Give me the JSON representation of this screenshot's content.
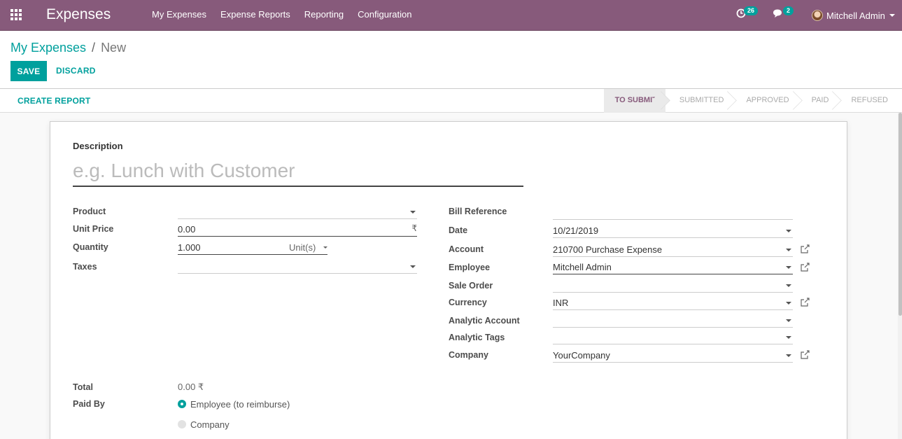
{
  "navbar": {
    "app_title": "Expenses",
    "menu": [
      "My Expenses",
      "Expense Reports",
      "Reporting",
      "Configuration"
    ],
    "activity_count": "26",
    "message_count": "2",
    "user_name": "Mitchell Admin",
    "bg_color": "#875a7b"
  },
  "breadcrumb": {
    "parent": "My Expenses",
    "separator": "/",
    "current": "New"
  },
  "buttons": {
    "save": "SAVE",
    "discard": "DISCARD",
    "create_report": "CREATE REPORT"
  },
  "status_stages": {
    "items": [
      "TO SUBMIT",
      "SUBMITTED",
      "APPROVED",
      "PAID",
      "REFUSED"
    ],
    "active": "TO SUBMIT"
  },
  "form": {
    "description_label": "Description",
    "description_placeholder": "e.g. Lunch with Customer",
    "left": {
      "product_label": "Product",
      "product_value": "",
      "unit_price_label": "Unit Price",
      "unit_price_value": "0.00",
      "currency_symbol": "₹",
      "quantity_label": "Quantity",
      "quantity_value": "1.000",
      "uom_value": "Unit(s)",
      "taxes_label": "Taxes",
      "taxes_value": ""
    },
    "right": {
      "bill_reference_label": "Bill Reference",
      "bill_reference_value": "",
      "date_label": "Date",
      "date_value": "10/21/2019",
      "account_label": "Account",
      "account_value": "210700 Purchase Expense",
      "employee_label": "Employee",
      "employee_value": "Mitchell Admin",
      "sale_order_label": "Sale Order",
      "sale_order_value": "",
      "currency_label": "Currency",
      "currency_value": "INR",
      "analytic_account_label": "Analytic Account",
      "analytic_account_value": "",
      "analytic_tags_label": "Analytic Tags",
      "analytic_tags_value": "",
      "company_label": "Company",
      "company_value": "YourCompany"
    },
    "total_label": "Total",
    "total_value": "0.00 ₹",
    "paid_by_label": "Paid By",
    "paid_by_options": [
      "Employee (to reimburse)",
      "Company"
    ],
    "paid_by_selected": "Employee (to reimburse)"
  },
  "colors": {
    "accent": "#00a09d",
    "brand": "#875a7b"
  }
}
